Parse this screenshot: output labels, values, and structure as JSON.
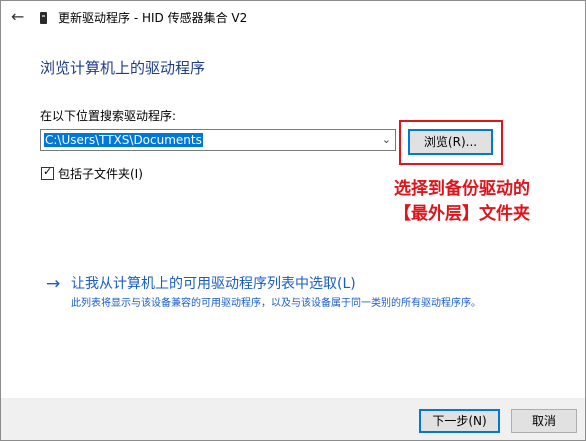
{
  "window": {
    "title": "更新驱动程序 - HID 传感器集合 V2",
    "back_icon": "←"
  },
  "main": {
    "heading": "浏览计算机上的驱动程序",
    "search_label": "在以下位置搜索驱动程序:",
    "path_value": "C:\\Users\\TTXS\\Documents",
    "dropdown_icon": "⌄",
    "browse_label": "浏览(R)...",
    "include_subfolders_label": "包括子文件夹(I)",
    "include_subfolders_checked": true,
    "checkmark": "✓"
  },
  "annotation": {
    "line1": "选择到备份驱动的",
    "line2": "【最外层】文件夹",
    "color": "#e0141b"
  },
  "option": {
    "arrow": "→",
    "title": "让我从计算机上的可用驱动程序列表中选取(L)",
    "description": "此列表将显示与该设备兼容的可用驱动程序，以及与该设备属于同一类别的所有驱动程序序。"
  },
  "footer": {
    "next_label": "下一步(N)",
    "cancel_label": "取消"
  },
  "colors": {
    "accent": "#0078d7",
    "link": "#1a5cc8",
    "heading": "#1f3d8a",
    "highlight": "#e0141b"
  }
}
